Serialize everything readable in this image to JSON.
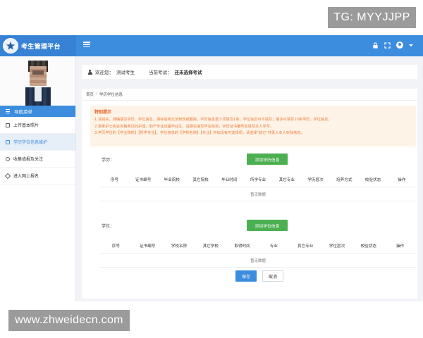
{
  "watermarks": {
    "top_right": "TG: MYYJJPP",
    "bottom_left": "www.zhweidecn.com"
  },
  "header": {
    "app_title": "考生管理平台"
  },
  "sidebar": {
    "menu_title": "导航菜单",
    "items": [
      {
        "label": "上传基本照片",
        "active": false
      },
      {
        "label": "学历学位信息维护",
        "active": true
      },
      {
        "label": "收集填报及关注",
        "active": false
      },
      {
        "label": "进入网上报名",
        "active": false
      }
    ]
  },
  "welcome": {
    "greeting": "欢迎您：",
    "user": "测试考生",
    "exam_label": "当前考试：",
    "exam_value": "还未选择考试"
  },
  "breadcrumb": {
    "home": "首页",
    "sep": "/",
    "current": "学历学位信息"
  },
  "notice": {
    "title": "特别提示",
    "lines": [
      "1.请如实、准确填写学历、学位信息，保存后将无法修改或删除。学历信息至少须填写1条，学位信息可不填写；最多可填写10条学历、学位信息。",
      "2.报考护士执业资格考试的护理、助产专业应届毕业生，请据实填写毕业院校，学历证书编号处填写本人学号。",
      "3.学历学位的【毕业院校】【所学专业】、学位信息的【学校名称】【专业】中如没有可选择项，请选择\"其它\"并录入本人实际信息。"
    ]
  },
  "education": {
    "label": "学历：",
    "add_button": "添加学历信息",
    "columns": [
      "序号",
      "证书编号",
      "毕业院校",
      "其它院校",
      "毕业时间",
      "所学专业",
      "其它专业",
      "学历层次",
      "培养方式",
      "校验状态",
      "操作"
    ],
    "empty_text": "暂无数据"
  },
  "degree": {
    "label": "学位：",
    "add_button": "添加学位信息",
    "columns": [
      "序号",
      "证书编号",
      "学校名称",
      "其它学校",
      "取得时间",
      "专业",
      "其它专业",
      "学位层次",
      "校验状态",
      "操作"
    ],
    "empty_text": "暂无数据"
  },
  "actions": {
    "save": "保存",
    "cancel": "取消"
  },
  "colors": {
    "primary": "#3c8dde",
    "add_button": "#4caf50",
    "notice_bg": "#fdf3e6",
    "notice_text": "#ef7d3c"
  }
}
